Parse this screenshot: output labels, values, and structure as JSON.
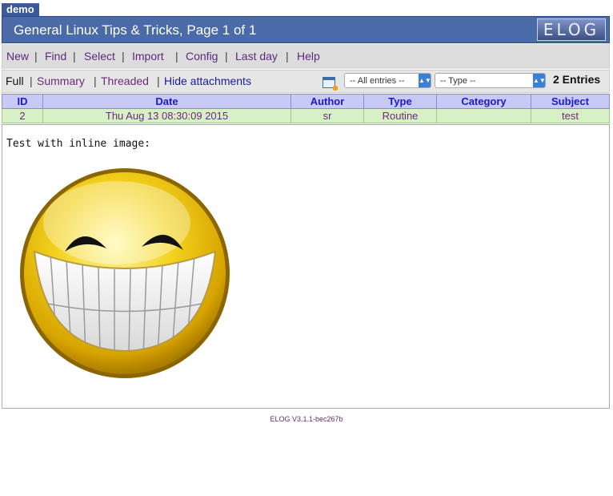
{
  "tab": {
    "label": "demo"
  },
  "header": {
    "title": "General Linux Tips & Tricks, Page 1 of 1",
    "logo_text": "ELOG"
  },
  "menu": {
    "items": [
      {
        "label": "New"
      },
      {
        "label": "Find"
      },
      {
        "label": "Select"
      },
      {
        "label": "Import"
      },
      {
        "label": "Config"
      },
      {
        "label": "Last day"
      },
      {
        "label": "Help"
      }
    ],
    "separator": "|"
  },
  "view": {
    "full": "Full",
    "summary": "Summary",
    "threaded": "Threaded",
    "hide_attachments": "Hide attachments"
  },
  "filters": {
    "entries_select": "-- All entries --",
    "type_select": "-- Type --",
    "entry_count": "2 Entries"
  },
  "table": {
    "columns": [
      "ID",
      "Date",
      "Author",
      "Type",
      "Category",
      "Subject"
    ],
    "rows": [
      {
        "id": "2",
        "date": "Thu Aug 13 08:30:09 2015",
        "author": "sr",
        "type": "Routine",
        "category": "",
        "subject": "test"
      }
    ]
  },
  "entry": {
    "text": "Test with inline image:",
    "image": "grinning-smiley-icon"
  },
  "footer": {
    "version": "ELOG V3.1.1-bec267b"
  }
}
